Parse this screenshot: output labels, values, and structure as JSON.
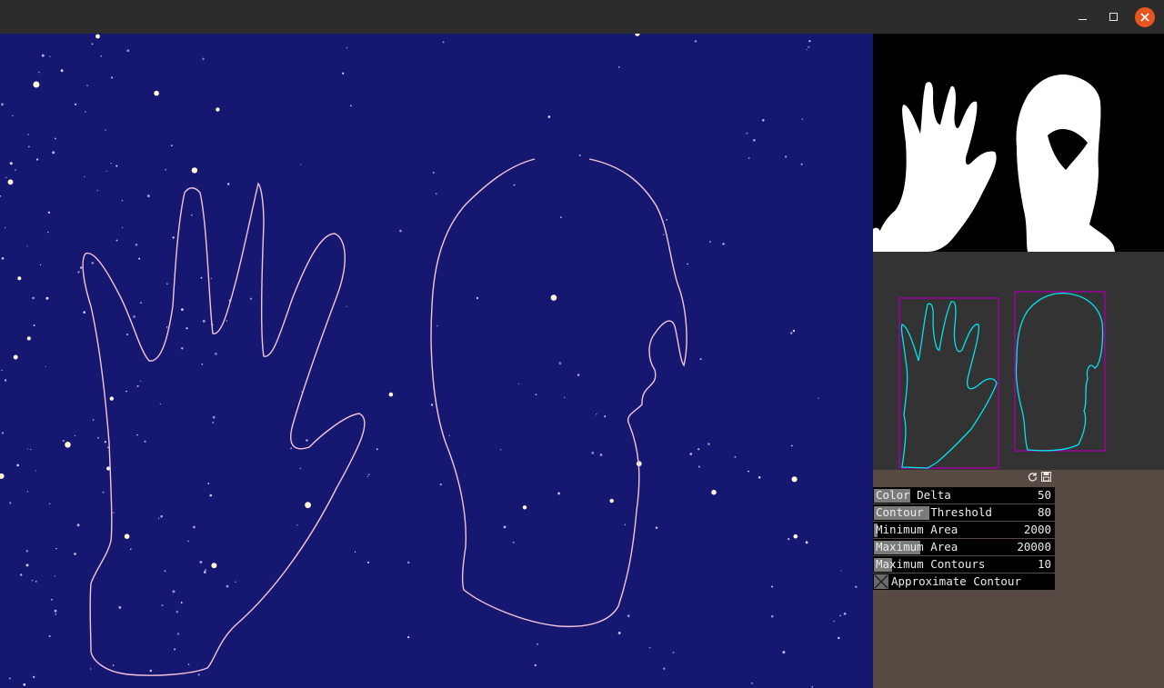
{
  "window": {
    "controls": {
      "minimize_icon": "minimize-icon",
      "maximize_icon": "maximize-icon",
      "close_icon": "close-icon",
      "close_color": "#e95420"
    }
  },
  "canvas": {
    "background": "#161771",
    "outline_color": "#f3c6dd"
  },
  "mask_view": {
    "background": "#000000",
    "fill": "#ffffff"
  },
  "contour_view": {
    "background": "#333333",
    "contour_color": "#00e5ee",
    "bbox_color": "#a400a4"
  },
  "panel": {
    "background": "#574a43",
    "header_icons": [
      "refresh-icon",
      "save-icon"
    ],
    "sliders": [
      {
        "label": "Color Delta",
        "value": "50",
        "fraction": 0.2
      },
      {
        "label": "Contour Threshold",
        "value": "80",
        "fraction": 0.31
      },
      {
        "label": "Minimum Area",
        "value": "2000",
        "fraction": 0.02
      },
      {
        "label": "Maximum Area",
        "value": "20000",
        "fraction": 0.26
      },
      {
        "label": "Maximum Contours",
        "value": "10",
        "fraction": 0.1
      }
    ],
    "toggle": {
      "label": "Approximate Contour",
      "checked": true
    }
  }
}
